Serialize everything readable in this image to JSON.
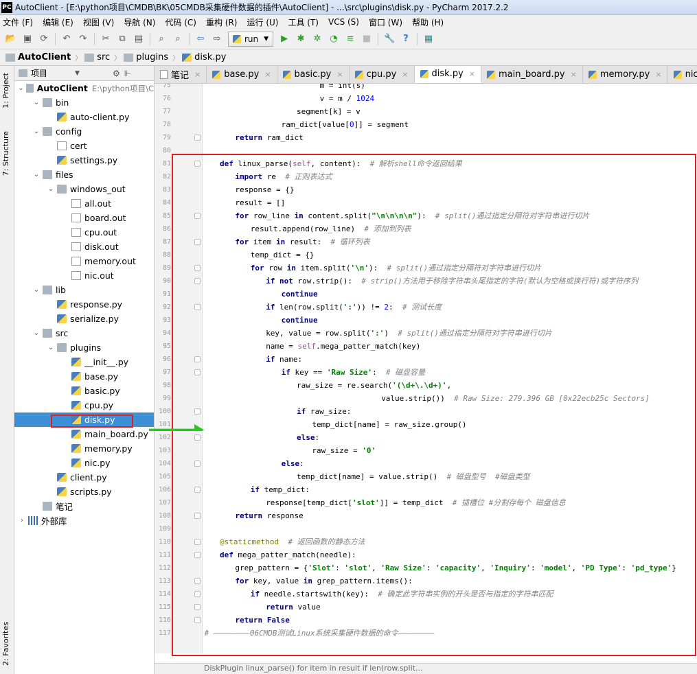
{
  "window": {
    "title": "AutoClient - [E:\\python项目\\CMDB\\BK\\05CMDB采集硬件数据的插件\\AutoClient] - ...\\src\\plugins\\disk.py - PyCharm 2017.2.2",
    "logo": "PC"
  },
  "menu": [
    "文件 (F)",
    "编辑 (E)",
    "视图 (V)",
    "导航 (N)",
    "代码 (C)",
    "重构 (R)",
    "运行 (U)",
    "工具 (T)",
    "VCS (S)",
    "窗口 (W)",
    "帮助 (H)"
  ],
  "toolbar": {
    "run_config": "run"
  },
  "breadcrumb": [
    "AutoClient",
    "src",
    "plugins",
    "disk.py"
  ],
  "side_tabs": {
    "project": "1: Project",
    "structure": "7: Structure",
    "favorites": "2: Favorites"
  },
  "project_panel": {
    "title": "项目"
  },
  "tree": [
    {
      "label": "AutoClient",
      "extra": "E:\\python项目\\C",
      "depth": 0,
      "type": "folder",
      "expanded": true
    },
    {
      "label": "bin",
      "depth": 1,
      "type": "folder",
      "expanded": true
    },
    {
      "label": "auto-client.py",
      "depth": 2,
      "type": "py"
    },
    {
      "label": "config",
      "depth": 1,
      "type": "folder",
      "expanded": true
    },
    {
      "label": "cert",
      "depth": 2,
      "type": "file"
    },
    {
      "label": "settings.py",
      "depth": 2,
      "type": "py"
    },
    {
      "label": "files",
      "depth": 1,
      "type": "folder",
      "expanded": true
    },
    {
      "label": "windows_out",
      "depth": 2,
      "type": "folder",
      "expanded": true
    },
    {
      "label": "all.out",
      "depth": 3,
      "type": "file"
    },
    {
      "label": "board.out",
      "depth": 3,
      "type": "file"
    },
    {
      "label": "cpu.out",
      "depth": 3,
      "type": "file"
    },
    {
      "label": "disk.out",
      "depth": 3,
      "type": "file"
    },
    {
      "label": "memory.out",
      "depth": 3,
      "type": "file"
    },
    {
      "label": "nic.out",
      "depth": 3,
      "type": "file"
    },
    {
      "label": "lib",
      "depth": 1,
      "type": "folder",
      "expanded": true
    },
    {
      "label": "response.py",
      "depth": 2,
      "type": "py"
    },
    {
      "label": "serialize.py",
      "depth": 2,
      "type": "py"
    },
    {
      "label": "src",
      "depth": 1,
      "type": "folder",
      "expanded": true
    },
    {
      "label": "plugins",
      "depth": 2,
      "type": "folder",
      "expanded": true
    },
    {
      "label": "__init__.py",
      "depth": 3,
      "type": "py"
    },
    {
      "label": "base.py",
      "depth": 3,
      "type": "py"
    },
    {
      "label": "basic.py",
      "depth": 3,
      "type": "py"
    },
    {
      "label": "cpu.py",
      "depth": 3,
      "type": "py"
    },
    {
      "label": "disk.py",
      "depth": 3,
      "type": "py",
      "selected": true
    },
    {
      "label": "main_board.py",
      "depth": 3,
      "type": "py"
    },
    {
      "label": "memory.py",
      "depth": 3,
      "type": "py"
    },
    {
      "label": "nic.py",
      "depth": 3,
      "type": "py"
    },
    {
      "label": "client.py",
      "depth": 2,
      "type": "py"
    },
    {
      "label": "scripts.py",
      "depth": 2,
      "type": "py"
    },
    {
      "label": "笔记",
      "depth": 1,
      "type": "folder"
    },
    {
      "label": "外部库",
      "depth": 0,
      "type": "lib",
      "expanded": false
    }
  ],
  "tabs": [
    {
      "label": "笔记",
      "py": false
    },
    {
      "label": "base.py",
      "py": true
    },
    {
      "label": "basic.py",
      "py": true
    },
    {
      "label": "cpu.py",
      "py": true
    },
    {
      "label": "disk.py",
      "py": true,
      "active": true
    },
    {
      "label": "main_board.py",
      "py": true
    },
    {
      "label": "memory.py",
      "py": true
    },
    {
      "label": "nic.py",
      "py": true
    }
  ],
  "code_lines": [
    {
      "n": "75",
      "indent": 13,
      "html": "m = int(s)"
    },
    {
      "n": "76",
      "indent": 13,
      "html": "v = m / <span class='num'>1024</span>"
    },
    {
      "n": "77",
      "indent": 10,
      "html": "segment[k] = v"
    },
    {
      "n": "78",
      "indent": 8,
      "html": "ram_dict[value[<span class='num'>0</span>]] = segment"
    },
    {
      "n": "79",
      "indent": 2,
      "html": "<span class='kw'>return</span> ram_dict"
    },
    {
      "n": "80",
      "indent": 0,
      "html": ""
    },
    {
      "n": "81",
      "indent": 0,
      "html": "<span class='kw'>def</span> linux_parse(<span class='self'>self</span>, content):  <span class='cm'># 解析shell命令返回结果</span>"
    },
    {
      "n": "82",
      "indent": 2,
      "html": "<span class='kw'>import</span> re  <span class='cm'># 正则表达式</span>"
    },
    {
      "n": "83",
      "indent": 2,
      "html": "response = {}"
    },
    {
      "n": "84",
      "indent": 2,
      "html": "result = []"
    },
    {
      "n": "85",
      "indent": 2,
      "html": "<span class='kw'>for</span> row_line <span class='kw'>in</span> content.split(<span class='str'>\"\\n\\n\\n\\n\"</span>):  <span class='cm'># split()通过指定分隔符对字符串进行切片</span>"
    },
    {
      "n": "86",
      "indent": 4,
      "html": "result.append(row_line)  <span class='cm'># 添加到列表</span>"
    },
    {
      "n": "87",
      "indent": 2,
      "html": "<span class='kw'>for</span> item <span class='kw'>in</span> result:  <span class='cm'># 循环列表</span>"
    },
    {
      "n": "88",
      "indent": 4,
      "html": "temp_dict = {}"
    },
    {
      "n": "89",
      "indent": 4,
      "html": "<span class='kw'>for</span> row <span class='kw'>in</span> item.split(<span class='str'>'\\n'</span>):  <span class='cm'># split()通过指定分隔符对字符串进行切片</span>"
    },
    {
      "n": "90",
      "indent": 6,
      "html": "<span class='kw'>if not</span> row.strip():  <span class='cm'># strip()方法用于移除字符串头尾指定的字符(默认为空格或换行符)或字符序列</span>"
    },
    {
      "n": "91",
      "indent": 8,
      "html": "<span class='kw'>continue</span>"
    },
    {
      "n": "92",
      "indent": 6,
      "html": "<span class='kw'>if</span> len(row.split(<span class='str'>':'</span>)) != <span class='num'>2</span>:  <span class='cm'># 测试长度</span>"
    },
    {
      "n": "93",
      "indent": 8,
      "html": "<span class='kw'>continue</span>"
    },
    {
      "n": "94",
      "indent": 6,
      "html": "key, value = row.split(<span class='str'>':'</span>)  <span class='cm'># split()通过指定分隔符对字符串进行切片</span>"
    },
    {
      "n": "95",
      "indent": 6,
      "html": "name = <span class='self'>self</span>.mega_patter_match(key)"
    },
    {
      "n": "96",
      "indent": 6,
      "html": "<span class='kw'>if</span> name:"
    },
    {
      "n": "97",
      "indent": 8,
      "html": "<span class='kw'>if</span> key == <span class='str'>'Raw Size'</span>:  <span class='cm'># 磁盘容量</span>"
    },
    {
      "n": "98",
      "indent": 10,
      "html": "raw_size = re.search(<span class='str'>'(\\d+\\.\\d+)'</span>,"
    },
    {
      "n": "99",
      "indent": 21,
      "html": "value.strip())  <span class='cm'># Raw Size: 279.396 GB [0x22ecb25c Sectors]</span>"
    },
    {
      "n": "100",
      "indent": 10,
      "html": "<span class='kw'>if</span> raw_size:"
    },
    {
      "n": "101",
      "indent": 12,
      "html": "temp_dict[name] = raw_size.group()"
    },
    {
      "n": "102",
      "indent": 10,
      "html": "<span class='kw'>else</span>:"
    },
    {
      "n": "103",
      "indent": 12,
      "html": "raw_size = <span class='str'>'0'</span>"
    },
    {
      "n": "104",
      "indent": 8,
      "html": "<span class='kw'>else</span>:"
    },
    {
      "n": "105",
      "indent": 10,
      "html": "temp_dict[name] = value.strip()  <span class='cm'># 磁盘型号  #磁盘类型</span>"
    },
    {
      "n": "106",
      "indent": 4,
      "html": "<span class='kw'>if</span> temp_dict:"
    },
    {
      "n": "107",
      "indent": 6,
      "html": "response[temp_dict[<span class='str'>'slot'</span>]] = temp_dict  <span class='cm'># 插槽位 #分割存每个 磁盘信息</span>"
    },
    {
      "n": "108",
      "indent": 2,
      "html": "<span class='kw'>return</span> response"
    },
    {
      "n": "109",
      "indent": 0,
      "html": ""
    },
    {
      "n": "110",
      "indent": 0,
      "html": "<span class='dec'>@staticmethod</span>  <span class='cm'># 返回函数的静态方法</span>"
    },
    {
      "n": "111",
      "indent": 0,
      "html": "<span class='kw'>def</span> mega_patter_match(needle):"
    },
    {
      "n": "112",
      "indent": 2,
      "html": "grep_pattern = {<span class='str'>'Slot'</span>: <span class='str'>'slot'</span>, <span class='str'>'Raw Size'</span>: <span class='str'>'capacity'</span>, <span class='str'>'Inquiry'</span>: <span class='str'>'model'</span>, <span class='str'>'PD Type'</span>: <span class='str'>'pd_type'</span>}"
    },
    {
      "n": "113",
      "indent": 2,
      "html": "<span class='kw'>for</span> key, value <span class='kw'>in</span> grep_pattern.items():"
    },
    {
      "n": "114",
      "indent": 4,
      "html": "<span class='kw'>if</span> needle.startswith(key):  <span class='cm'># 确定此字符串实例的开头是否与指定的字符串匹配</span>"
    },
    {
      "n": "115",
      "indent": 6,
      "html": "<span class='kw'>return</span> value"
    },
    {
      "n": "116",
      "indent": 2,
      "html": "<span class='kw'>return False</span>"
    },
    {
      "n": "117",
      "indent": -2,
      "html": "<span class='cm'># ————————06CMDB测试Linux系统采集硬件数据的命令————————</span>"
    }
  ],
  "status_bar": "DiskPlugin  linux_parse()  for item in result  if len(row.split..."
}
